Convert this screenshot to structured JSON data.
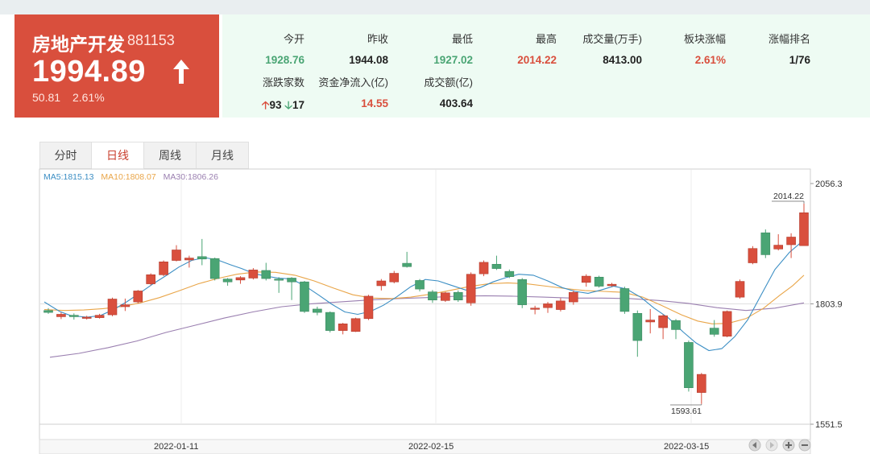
{
  "quote": {
    "name": "房地产开发",
    "code": "881153",
    "price": "1994.89",
    "change": "50.81",
    "change_pct": "2.61%",
    "up_color": "#d94f3d",
    "down_color": "#4aa574"
  },
  "stats": [
    {
      "label": "今开",
      "value": "1928.76",
      "tone": "green"
    },
    {
      "label": "昨收",
      "value": "1944.08",
      "tone": "dark"
    },
    {
      "label": "最低",
      "value": "1927.02",
      "tone": "green"
    },
    {
      "label": "最高",
      "value": "2014.22",
      "tone": "red"
    },
    {
      "label": "成交量(万手)",
      "value": "8413.00",
      "tone": "dark"
    },
    {
      "label": "板块涨幅",
      "value": "2.61%",
      "tone": "red"
    },
    {
      "label": "涨幅排名",
      "value": "1/76",
      "tone": "dark"
    },
    {
      "label": "涨跌家数",
      "up_count": "93",
      "down_count": "17"
    },
    {
      "label": "资金净流入(亿)",
      "value": "14.55",
      "tone": "red"
    },
    {
      "label": "成交额(亿)",
      "value": "403.64",
      "tone": "dark"
    }
  ],
  "tabs": [
    "分时",
    "日线",
    "周线",
    "月线"
  ],
  "active_tab": 1,
  "ma_legend": {
    "ma5": "MA5:1815.13",
    "ma10": "MA10:1808.07",
    "ma30": "MA30:1806.26",
    "ma5_color": "#3b8ec4",
    "ma10_color": "#e9a548",
    "ma30_color": "#9a7fb0"
  },
  "chart_data": {
    "type": "candlestick",
    "y_ticks": [
      "2056.3",
      "1803.9",
      "1551.5"
    ],
    "ylim": [
      1551.5,
      2056.3
    ],
    "x_tick_labels": [
      "2022-01-11",
      "2022-02-15",
      "2022-03-15"
    ],
    "annotations": {
      "high": "2014.22",
      "low": "1593.61"
    },
    "candles": [
      [
        1790,
        1786,
        1795,
        1783
      ],
      [
        1777,
        1782,
        1786,
        1772
      ],
      [
        1780,
        1777,
        1784,
        1771
      ],
      [
        1774,
        1776,
        1779,
        1771
      ],
      [
        1775,
        1780,
        1783,
        1773
      ],
      [
        1781,
        1814,
        1817,
        1778
      ],
      [
        1798,
        1802,
        1815,
        1789
      ],
      [
        1808,
        1831,
        1833,
        1805
      ],
      [
        1846,
        1865,
        1868,
        1843
      ],
      [
        1865,
        1892,
        1895,
        1862
      ],
      [
        1895,
        1917,
        1927,
        1893
      ],
      [
        1896,
        1900,
        1905,
        1880
      ],
      [
        1903,
        1898,
        1940,
        1885
      ],
      [
        1899,
        1857,
        1901,
        1853
      ],
      [
        1856,
        1850,
        1858,
        1842
      ],
      [
        1854,
        1859,
        1862,
        1846
      ],
      [
        1858,
        1875,
        1879,
        1855
      ],
      [
        1874,
        1857,
        1890,
        1853
      ],
      [
        1856,
        1854,
        1860,
        1827
      ],
      [
        1858,
        1850,
        1860,
        1812
      ],
      [
        1850,
        1788,
        1852,
        1785
      ],
      [
        1793,
        1786,
        1798,
        1780
      ],
      [
        1786,
        1748,
        1788,
        1744
      ],
      [
        1748,
        1762,
        1764,
        1740
      ],
      [
        1746,
        1773,
        1775,
        1745
      ],
      [
        1773,
        1820,
        1823,
        1770
      ],
      [
        1842,
        1852,
        1856,
        1832
      ],
      [
        1850,
        1868,
        1873,
        1847
      ],
      [
        1889,
        1882,
        1913,
        1880
      ],
      [
        1853,
        1835,
        1856,
        1830
      ],
      [
        1829,
        1812,
        1833,
        1806
      ],
      [
        1811,
        1827,
        1829,
        1808
      ],
      [
        1828,
        1812,
        1832,
        1808
      ],
      [
        1806,
        1866,
        1870,
        1800
      ],
      [
        1867,
        1891,
        1895,
        1862
      ],
      [
        1887,
        1878,
        1905,
        1875
      ],
      [
        1872,
        1861,
        1876,
        1858
      ],
      [
        1855,
        1802,
        1858,
        1795
      ],
      [
        1795,
        1795,
        1800,
        1782
      ],
      [
        1796,
        1804,
        1808,
        1785
      ],
      [
        1792,
        1810,
        1816,
        1788
      ],
      [
        1808,
        1828,
        1832,
        1802
      ],
      [
        1849,
        1862,
        1866,
        1840
      ],
      [
        1860,
        1841,
        1863,
        1838
      ],
      [
        1842,
        1845,
        1848,
        1840
      ],
      [
        1836,
        1788,
        1840,
        1783
      ],
      [
        1784,
        1727,
        1790,
        1693
      ],
      [
        1766,
        1770,
        1793,
        1742
      ],
      [
        1754,
        1779,
        1782,
        1730
      ],
      [
        1769,
        1750,
        1772,
        1730
      ],
      [
        1723,
        1628,
        1727,
        1620
      ],
      [
        1618,
        1656,
        1659,
        1594
      ],
      [
        1753,
        1740,
        1770,
        1735
      ],
      [
        1736,
        1788,
        1790,
        1734
      ],
      [
        1818,
        1851,
        1855,
        1815
      ],
      [
        1890,
        1920,
        1925,
        1887
      ],
      [
        1953,
        1907,
        1960,
        1900
      ],
      [
        1919,
        1927,
        1950,
        1916
      ],
      [
        1928,
        1944,
        1952,
        1900
      ],
      [
        1926,
        1995,
        2014,
        1926
      ]
    ],
    "ma5": [
      [
        55,
        1808
      ],
      [
        74,
        1788
      ],
      [
        88,
        1779
      ],
      [
        108,
        1776
      ],
      [
        124,
        1779
      ],
      [
        140,
        1791
      ],
      [
        157,
        1808
      ],
      [
        173,
        1826
      ],
      [
        190,
        1846
      ],
      [
        206,
        1863
      ],
      [
        222,
        1881
      ],
      [
        238,
        1895
      ],
      [
        254,
        1901
      ],
      [
        270,
        1896
      ],
      [
        286,
        1886
      ],
      [
        300,
        1878
      ],
      [
        316,
        1867
      ],
      [
        330,
        1862
      ],
      [
        346,
        1858
      ],
      [
        362,
        1856
      ],
      [
        380,
        1840
      ],
      [
        396,
        1822
      ],
      [
        412,
        1803
      ],
      [
        428,
        1787
      ],
      [
        444,
        1782
      ],
      [
        460,
        1788
      ],
      [
        476,
        1801
      ],
      [
        492,
        1818
      ],
      [
        510,
        1840
      ],
      [
        528,
        1855
      ],
      [
        544,
        1852
      ],
      [
        560,
        1843
      ],
      [
        578,
        1833
      ],
      [
        596,
        1838
      ],
      [
        612,
        1850
      ],
      [
        628,
        1859
      ],
      [
        644,
        1866
      ],
      [
        662,
        1864
      ],
      [
        680,
        1852
      ],
      [
        698,
        1838
      ],
      [
        714,
        1830
      ],
      [
        730,
        1826
      ],
      [
        746,
        1833
      ],
      [
        762,
        1841
      ],
      [
        778,
        1835
      ],
      [
        796,
        1817
      ],
      [
        812,
        1795
      ],
      [
        830,
        1774
      ],
      [
        848,
        1745
      ],
      [
        864,
        1722
      ],
      [
        880,
        1706
      ],
      [
        896,
        1710
      ],
      [
        912,
        1735
      ],
      [
        928,
        1770
      ],
      [
        944,
        1820
      ],
      [
        962,
        1876
      ],
      [
        980,
        1912
      ],
      [
        998,
        1938
      ]
    ],
    "ma10": [
      [
        55,
        1792
      ],
      [
        80,
        1790
      ],
      [
        104,
        1791
      ],
      [
        128,
        1794
      ],
      [
        150,
        1798
      ],
      [
        174,
        1806
      ],
      [
        198,
        1817
      ],
      [
        222,
        1831
      ],
      [
        246,
        1846
      ],
      [
        270,
        1857
      ],
      [
        294,
        1866
      ],
      [
        318,
        1871
      ],
      [
        342,
        1870
      ],
      [
        366,
        1864
      ],
      [
        390,
        1852
      ],
      [
        414,
        1837
      ],
      [
        438,
        1823
      ],
      [
        462,
        1816
      ],
      [
        486,
        1815
      ],
      [
        510,
        1818
      ],
      [
        534,
        1824
      ],
      [
        558,
        1832
      ],
      [
        582,
        1840
      ],
      [
        606,
        1846
      ],
      [
        630,
        1848
      ],
      [
        654,
        1846
      ],
      [
        678,
        1841
      ],
      [
        702,
        1836
      ],
      [
        726,
        1832
      ],
      [
        750,
        1830
      ],
      [
        774,
        1828
      ],
      [
        798,
        1818
      ],
      [
        822,
        1800
      ],
      [
        846,
        1781
      ],
      [
        866,
        1768
      ],
      [
        884,
        1762
      ],
      [
        904,
        1763
      ],
      [
        926,
        1773
      ],
      [
        948,
        1795
      ],
      [
        968,
        1822
      ],
      [
        984,
        1842
      ],
      [
        998,
        1864
      ]
    ],
    "ma30": [
      [
        62,
        1692
      ],
      [
        98,
        1700
      ],
      [
        134,
        1712
      ],
      [
        170,
        1726
      ],
      [
        206,
        1744
      ],
      [
        242,
        1759
      ],
      [
        278,
        1774
      ],
      [
        314,
        1787
      ],
      [
        350,
        1798
      ],
      [
        386,
        1804
      ],
      [
        422,
        1808
      ],
      [
        458,
        1812
      ],
      [
        494,
        1815
      ],
      [
        530,
        1817
      ],
      [
        566,
        1820
      ],
      [
        602,
        1821
      ],
      [
        638,
        1820
      ],
      [
        674,
        1818
      ],
      [
        710,
        1816
      ],
      [
        746,
        1816
      ],
      [
        782,
        1815
      ],
      [
        818,
        1811
      ],
      [
        854,
        1805
      ],
      [
        890,
        1796
      ],
      [
        926,
        1790
      ],
      [
        962,
        1795
      ],
      [
        998,
        1806
      ]
    ]
  }
}
